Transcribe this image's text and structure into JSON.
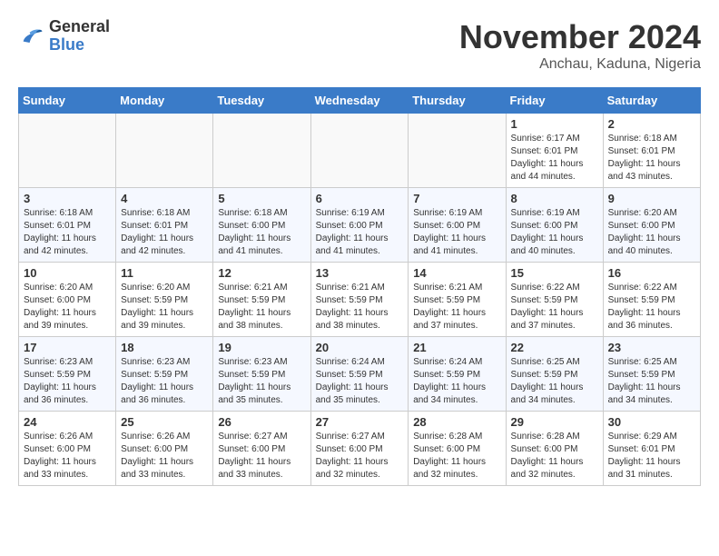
{
  "header": {
    "logo_general": "General",
    "logo_blue": "Blue",
    "month_title": "November 2024",
    "location": "Anchau, Kaduna, Nigeria"
  },
  "weekdays": [
    "Sunday",
    "Monday",
    "Tuesday",
    "Wednesday",
    "Thursday",
    "Friday",
    "Saturday"
  ],
  "weeks": [
    [
      {
        "day": "",
        "text": ""
      },
      {
        "day": "",
        "text": ""
      },
      {
        "day": "",
        "text": ""
      },
      {
        "day": "",
        "text": ""
      },
      {
        "day": "",
        "text": ""
      },
      {
        "day": "1",
        "text": "Sunrise: 6:17 AM\nSunset: 6:01 PM\nDaylight: 11 hours and 44 minutes."
      },
      {
        "day": "2",
        "text": "Sunrise: 6:18 AM\nSunset: 6:01 PM\nDaylight: 11 hours and 43 minutes."
      }
    ],
    [
      {
        "day": "3",
        "text": "Sunrise: 6:18 AM\nSunset: 6:01 PM\nDaylight: 11 hours and 42 minutes."
      },
      {
        "day": "4",
        "text": "Sunrise: 6:18 AM\nSunset: 6:01 PM\nDaylight: 11 hours and 42 minutes."
      },
      {
        "day": "5",
        "text": "Sunrise: 6:18 AM\nSunset: 6:00 PM\nDaylight: 11 hours and 41 minutes."
      },
      {
        "day": "6",
        "text": "Sunrise: 6:19 AM\nSunset: 6:00 PM\nDaylight: 11 hours and 41 minutes."
      },
      {
        "day": "7",
        "text": "Sunrise: 6:19 AM\nSunset: 6:00 PM\nDaylight: 11 hours and 41 minutes."
      },
      {
        "day": "8",
        "text": "Sunrise: 6:19 AM\nSunset: 6:00 PM\nDaylight: 11 hours and 40 minutes."
      },
      {
        "day": "9",
        "text": "Sunrise: 6:20 AM\nSunset: 6:00 PM\nDaylight: 11 hours and 40 minutes."
      }
    ],
    [
      {
        "day": "10",
        "text": "Sunrise: 6:20 AM\nSunset: 6:00 PM\nDaylight: 11 hours and 39 minutes."
      },
      {
        "day": "11",
        "text": "Sunrise: 6:20 AM\nSunset: 5:59 PM\nDaylight: 11 hours and 39 minutes."
      },
      {
        "day": "12",
        "text": "Sunrise: 6:21 AM\nSunset: 5:59 PM\nDaylight: 11 hours and 38 minutes."
      },
      {
        "day": "13",
        "text": "Sunrise: 6:21 AM\nSunset: 5:59 PM\nDaylight: 11 hours and 38 minutes."
      },
      {
        "day": "14",
        "text": "Sunrise: 6:21 AM\nSunset: 5:59 PM\nDaylight: 11 hours and 37 minutes."
      },
      {
        "day": "15",
        "text": "Sunrise: 6:22 AM\nSunset: 5:59 PM\nDaylight: 11 hours and 37 minutes."
      },
      {
        "day": "16",
        "text": "Sunrise: 6:22 AM\nSunset: 5:59 PM\nDaylight: 11 hours and 36 minutes."
      }
    ],
    [
      {
        "day": "17",
        "text": "Sunrise: 6:23 AM\nSunset: 5:59 PM\nDaylight: 11 hours and 36 minutes."
      },
      {
        "day": "18",
        "text": "Sunrise: 6:23 AM\nSunset: 5:59 PM\nDaylight: 11 hours and 36 minutes."
      },
      {
        "day": "19",
        "text": "Sunrise: 6:23 AM\nSunset: 5:59 PM\nDaylight: 11 hours and 35 minutes."
      },
      {
        "day": "20",
        "text": "Sunrise: 6:24 AM\nSunset: 5:59 PM\nDaylight: 11 hours and 35 minutes."
      },
      {
        "day": "21",
        "text": "Sunrise: 6:24 AM\nSunset: 5:59 PM\nDaylight: 11 hours and 34 minutes."
      },
      {
        "day": "22",
        "text": "Sunrise: 6:25 AM\nSunset: 5:59 PM\nDaylight: 11 hours and 34 minutes."
      },
      {
        "day": "23",
        "text": "Sunrise: 6:25 AM\nSunset: 5:59 PM\nDaylight: 11 hours and 34 minutes."
      }
    ],
    [
      {
        "day": "24",
        "text": "Sunrise: 6:26 AM\nSunset: 6:00 PM\nDaylight: 11 hours and 33 minutes."
      },
      {
        "day": "25",
        "text": "Sunrise: 6:26 AM\nSunset: 6:00 PM\nDaylight: 11 hours and 33 minutes."
      },
      {
        "day": "26",
        "text": "Sunrise: 6:27 AM\nSunset: 6:00 PM\nDaylight: 11 hours and 33 minutes."
      },
      {
        "day": "27",
        "text": "Sunrise: 6:27 AM\nSunset: 6:00 PM\nDaylight: 11 hours and 32 minutes."
      },
      {
        "day": "28",
        "text": "Sunrise: 6:28 AM\nSunset: 6:00 PM\nDaylight: 11 hours and 32 minutes."
      },
      {
        "day": "29",
        "text": "Sunrise: 6:28 AM\nSunset: 6:00 PM\nDaylight: 11 hours and 32 minutes."
      },
      {
        "day": "30",
        "text": "Sunrise: 6:29 AM\nSunset: 6:01 PM\nDaylight: 11 hours and 31 minutes."
      }
    ]
  ]
}
